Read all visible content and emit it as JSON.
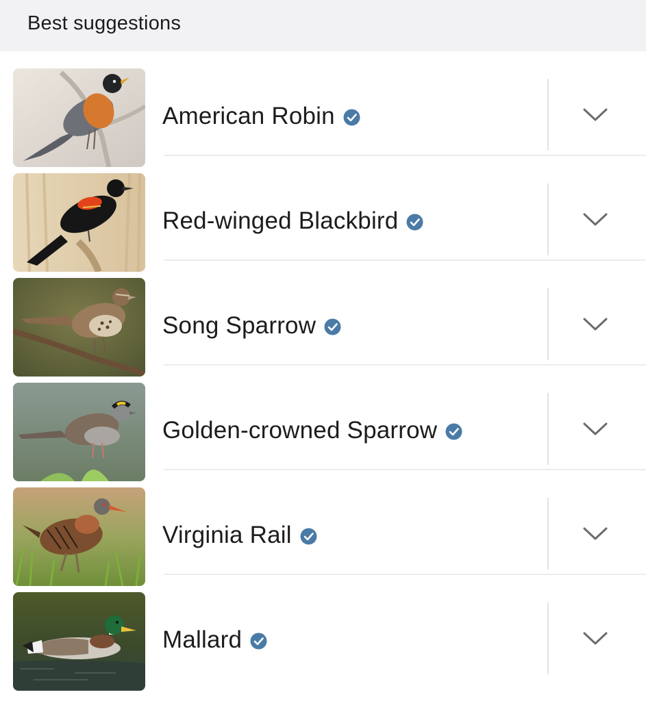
{
  "header": {
    "title": "Best suggestions"
  },
  "suggestions": [
    {
      "name": "American Robin",
      "photo_icon": "american-robin-photo",
      "badge_icon": "verified-icon",
      "action_icon": "chevron-down-icon"
    },
    {
      "name": "Red-winged Blackbird",
      "photo_icon": "red-winged-blackbird-photo",
      "badge_icon": "verified-icon",
      "action_icon": "chevron-down-icon"
    },
    {
      "name": "Song Sparrow",
      "photo_icon": "song-sparrow-photo",
      "badge_icon": "verified-icon",
      "action_icon": "chevron-down-icon"
    },
    {
      "name": "Golden-crowned Sparrow",
      "photo_icon": "golden-crowned-sparrow-photo",
      "badge_icon": "verified-icon",
      "action_icon": "chevron-down-icon"
    },
    {
      "name": "Virginia Rail",
      "photo_icon": "virginia-rail-photo",
      "badge_icon": "verified-icon",
      "action_icon": "chevron-down-icon"
    },
    {
      "name": "Mallard",
      "photo_icon": "mallard-photo",
      "badge_icon": "verified-icon",
      "action_icon": "chevron-down-icon"
    }
  ],
  "colors": {
    "header_bg": "#f2f2f4",
    "text": "#1c1c1e",
    "verified_badge": "#4a7ba6",
    "chevron": "#6b6b70",
    "separator": "#e3e3e6"
  }
}
